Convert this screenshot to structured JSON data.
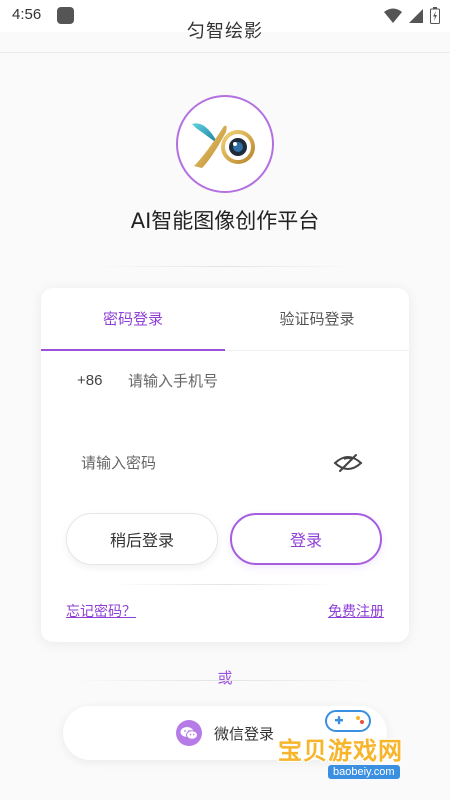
{
  "status_bar": {
    "time": "4:56"
  },
  "app_bar": {
    "title": "匀智绘影"
  },
  "brand": {
    "logo_text": "YO",
    "headline": "AI智能图像创作平台",
    "accent_color": "#9a52dd"
  },
  "login_card": {
    "tabs": [
      {
        "label": "密码登录",
        "active": true
      },
      {
        "label": "验证码登录",
        "active": false
      }
    ],
    "phone": {
      "country_code": "+86",
      "placeholder": "请输入手机号",
      "value": ""
    },
    "password": {
      "placeholder": "请输入密码",
      "value": "",
      "toggle_icon": "eye-off-icon"
    },
    "buttons": {
      "later_label": "稍后登录",
      "login_label": "登录"
    },
    "links": {
      "forgot": "忘记密码？",
      "register": "免费注册"
    }
  },
  "alt_login": {
    "or_text": "或",
    "wechat_label": "微信登录",
    "wechat_icon": "wechat-icon"
  },
  "watermark": {
    "text": "宝贝游戏网",
    "url": "baobeiy.com"
  }
}
